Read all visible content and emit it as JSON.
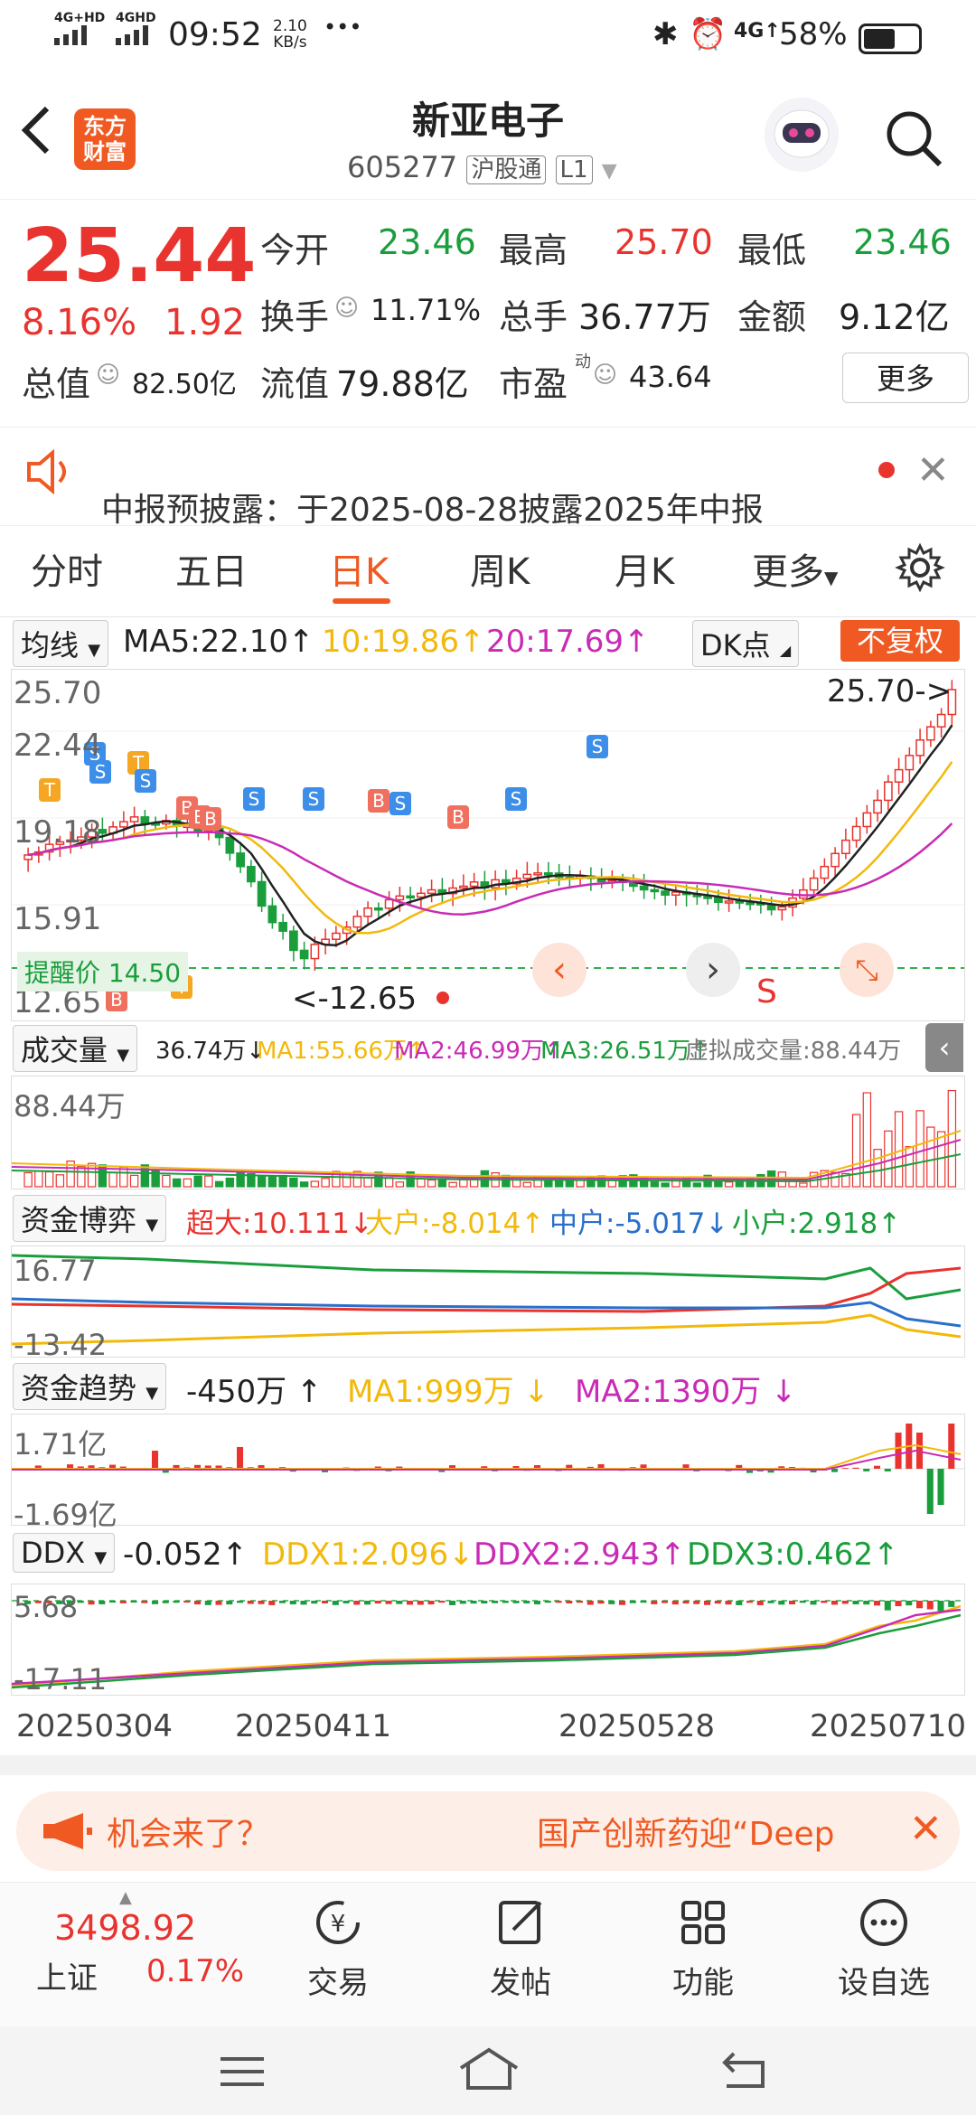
{
  "status": {
    "net1": "4G+HD",
    "net2": "4GHD",
    "time": "09:52",
    "speed_val": "2.10",
    "speed_unit": "KB/s",
    "dots": "•••",
    "net3": "4G↑",
    "battery": "58%"
  },
  "header": {
    "logo_line1": "东方",
    "logo_line2": "财富",
    "stock_name": "新亚电子",
    "stock_code": "605277",
    "exchange": "沪股通",
    "level": "L1"
  },
  "quote": {
    "price": "25.44",
    "change_pct": "8.16%",
    "change_amt": "1.92",
    "open_label": "今开",
    "open": "23.46",
    "high_label": "最高",
    "high": "25.70",
    "low_label": "最低",
    "low": "23.46",
    "turnover_label": "换手",
    "turnover": "11.71%",
    "volume_label": "总手",
    "volume": "36.77万",
    "amount_label": "金额",
    "amount": "9.12亿",
    "mcap_label": "总值",
    "mcap": "82.50亿",
    "float_label": "流值",
    "float_cap": "79.88亿",
    "pe_label": "市盈",
    "pe_sup": "动",
    "pe": "43.64",
    "more_button": "更多"
  },
  "notice": {
    "text": "中报预披露：于2025-08-28披露2025年中报"
  },
  "tabs": [
    "分时",
    "五日",
    "日K",
    "周K",
    "月K",
    "更多"
  ],
  "active_tab": 2,
  "ma_row": {
    "selector": "均线",
    "ma5": "MA5:22.10↑",
    "ma10": "10:19.86↑",
    "ma20": "20:17.69↑",
    "dk_button": "DK点",
    "adjust_button": "不复权"
  },
  "kline": {
    "y_labels": [
      "25.70",
      "22.44",
      "19.18",
      "15.91",
      "12.65"
    ],
    "max_marker": "25.70->",
    "min_marker": "<-12.65",
    "alert_label": "提醒价 14.50",
    "signal_s": "S"
  },
  "volume_row": {
    "selector": "成交量",
    "vol": "36.74万↓",
    "ma1": "MA1:55.66万↑",
    "ma2": "MA2:46.99万↑",
    "ma3": "MA3:26.51万↑",
    "virtual": "虚拟成交量:88.44万"
  },
  "volume_axis": "88.44万",
  "fund_game_row": {
    "selector": "资金博弈",
    "super": "超大:10.111↓",
    "large": "大户:-8.014↑",
    "mid": "中户:-5.017↓",
    "small": "小户:2.918↑"
  },
  "fund_game_axis": [
    "16.77",
    "-13.42"
  ],
  "fund_trend_row": {
    "selector": "资金趋势",
    "value": "-450万 ↑",
    "ma1": "MA1:999万 ↓",
    "ma2": "MA2:1390万 ↓"
  },
  "fund_trend_axis": [
    "1.71亿",
    "-1.69亿"
  ],
  "ddx_row": {
    "selector": "DDX",
    "value": "-0.052↑",
    "ddx1": "DDX1:2.096↓",
    "ddx2": "DDX2:2.943↑",
    "ddx3": "DDX3:0.462↑"
  },
  "ddx_axis": [
    "5.68",
    "-17.11"
  ],
  "dates": [
    "20250304",
    "20250411",
    "20250528",
    "20250710"
  ],
  "banner": {
    "left": "机会来了？",
    "right": "国产创新药迎“Deep"
  },
  "index": {
    "value": "3498.92",
    "name": "上证",
    "change": "0.17%"
  },
  "nav": [
    "交易",
    "发帖",
    "功能",
    "设自选"
  ],
  "colors": {
    "up": "#e8332e",
    "down": "#1a9e3c",
    "ma5": "#222222",
    "ma10": "#f2b90c",
    "ma20": "#c92bb5",
    "accent": "#f05a22"
  }
}
